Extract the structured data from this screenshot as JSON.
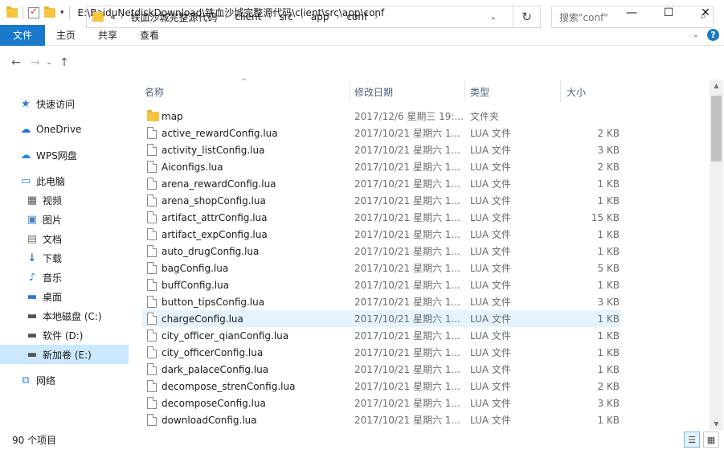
{
  "window": {
    "path_title": "E:\\BaiduNetdiskDownload\\铁血沙城完整源代码\\client\\src\\app\\conf",
    "minimize": "—",
    "maximize": "☐",
    "close": "✕"
  },
  "ribbon": {
    "tabs": [
      "文件",
      "主页",
      "共享",
      "查看"
    ]
  },
  "address": {
    "prefix": "«",
    "crumbs": [
      "铁血沙城完整源代码",
      "client",
      "src",
      "app",
      "conf"
    ]
  },
  "search": {
    "placeholder": "搜索\"conf\""
  },
  "sidebar": {
    "items": [
      {
        "label": "快速访问",
        "icon": "star-icon"
      },
      {
        "label": "OneDrive",
        "icon": "cloud-icon"
      },
      {
        "label": "WPS网盘",
        "icon": "wps-cloud-icon"
      },
      {
        "label": "此电脑",
        "icon": "computer-icon"
      },
      {
        "label": "视频",
        "icon": "video-icon"
      },
      {
        "label": "图片",
        "icon": "picture-icon"
      },
      {
        "label": "文档",
        "icon": "document-icon"
      },
      {
        "label": "下载",
        "icon": "download-icon"
      },
      {
        "label": "音乐",
        "icon": "music-icon"
      },
      {
        "label": "桌面",
        "icon": "desktop-icon"
      },
      {
        "label": "本地磁盘 (C:)",
        "icon": "drive-icon"
      },
      {
        "label": "软件 (D:)",
        "icon": "drive-icon"
      },
      {
        "label": "新加卷 (E:)",
        "icon": "drive-icon"
      },
      {
        "label": "网络",
        "icon": "network-icon"
      }
    ]
  },
  "columns": {
    "name": "名称",
    "date": "修改日期",
    "type": "类型",
    "size": "大小"
  },
  "files": [
    {
      "name": "map",
      "date": "2017/12/6 星期三 19:...",
      "type": "文件夹",
      "size": "",
      "kind": "folder"
    },
    {
      "name": "active_rewardConfig.lua",
      "date": "2017/10/21 星期六 1...",
      "type": "LUA 文件",
      "size": "2 KB",
      "kind": "file"
    },
    {
      "name": "activity_listConfig.lua",
      "date": "2017/10/21 星期六 1...",
      "type": "LUA 文件",
      "size": "3 KB",
      "kind": "file"
    },
    {
      "name": "Aiconfigs.lua",
      "date": "2017/10/21 星期六 1...",
      "type": "LUA 文件",
      "size": "2 KB",
      "kind": "file"
    },
    {
      "name": "arena_rewardConfig.lua",
      "date": "2017/10/21 星期六 1...",
      "type": "LUA 文件",
      "size": "1 KB",
      "kind": "file"
    },
    {
      "name": "arena_shopConfig.lua",
      "date": "2017/10/21 星期六 1...",
      "type": "LUA 文件",
      "size": "1 KB",
      "kind": "file"
    },
    {
      "name": "artifact_attrConfig.lua",
      "date": "2017/10/21 星期六 1...",
      "type": "LUA 文件",
      "size": "15 KB",
      "kind": "file"
    },
    {
      "name": "artifact_expConfig.lua",
      "date": "2017/10/21 星期六 1...",
      "type": "LUA 文件",
      "size": "1 KB",
      "kind": "file"
    },
    {
      "name": "auto_drugConfig.lua",
      "date": "2017/10/21 星期六 1...",
      "type": "LUA 文件",
      "size": "1 KB",
      "kind": "file"
    },
    {
      "name": "bagConfig.lua",
      "date": "2017/10/21 星期六 1...",
      "type": "LUA 文件",
      "size": "5 KB",
      "kind": "file"
    },
    {
      "name": "buffConfig.lua",
      "date": "2017/10/21 星期六 1...",
      "type": "LUA 文件",
      "size": "1 KB",
      "kind": "file"
    },
    {
      "name": "button_tipsConfig.lua",
      "date": "2017/10/21 星期六 1...",
      "type": "LUA 文件",
      "size": "3 KB",
      "kind": "file"
    },
    {
      "name": "chargeConfig.lua",
      "date": "2017/10/21 星期六 1...",
      "type": "LUA 文件",
      "size": "1 KB",
      "kind": "file"
    },
    {
      "name": "city_officer_qianConfig.lua",
      "date": "2017/10/21 星期六 1...",
      "type": "LUA 文件",
      "size": "1 KB",
      "kind": "file"
    },
    {
      "name": "city_officerConfig.lua",
      "date": "2017/10/21 星期六 1...",
      "type": "LUA 文件",
      "size": "1 KB",
      "kind": "file"
    },
    {
      "name": "dark_palaceConfig.lua",
      "date": "2017/10/21 星期六 1...",
      "type": "LUA 文件",
      "size": "1 KB",
      "kind": "file"
    },
    {
      "name": "decompose_strenConfig.lua",
      "date": "2017/10/21 星期六 1...",
      "type": "LUA 文件",
      "size": "2 KB",
      "kind": "file"
    },
    {
      "name": "decomposeConfig.lua",
      "date": "2017/10/21 星期六 1...",
      "type": "LUA 文件",
      "size": "3 KB",
      "kind": "file"
    },
    {
      "name": "downloadConfig.lua",
      "date": "2017/10/21 星期六 1...",
      "type": "LUA 文件",
      "size": "1 KB",
      "kind": "file"
    }
  ],
  "status": {
    "count": "90 个项目"
  },
  "colors": {
    "accent": "#1979ca",
    "selected": "#cce8ff",
    "hover": "#e5f3ff",
    "folder": "#f5c542"
  }
}
